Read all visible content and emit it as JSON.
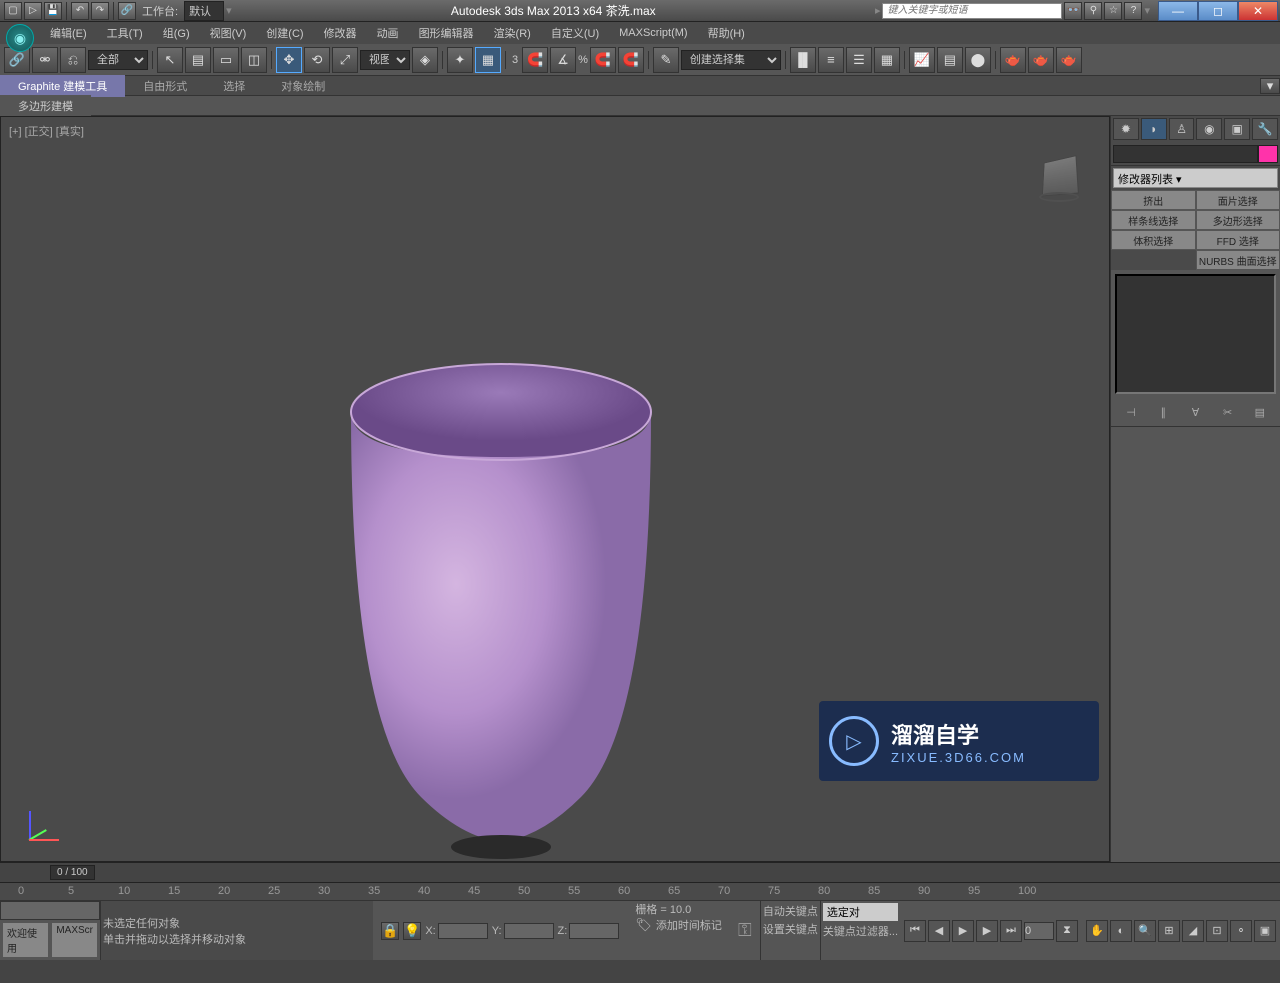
{
  "titlebar": {
    "app_title": "Autodesk 3ds Max  2013 x64     茶洗.max",
    "workspace_label": "工作台:",
    "workspace_value": "默认",
    "search_placeholder": "键入关键字或短语"
  },
  "menus": {
    "edit": "编辑(E)",
    "tools": "工具(T)",
    "group": "组(G)",
    "views": "视图(V)",
    "create": "创建(C)",
    "modifiers": "修改器",
    "animation": "动画",
    "graph": "图形编辑器",
    "rendering": "渲染(R)",
    "customize": "自定义(U)",
    "maxscript": "MAXScript(M)",
    "help": "帮助(H)"
  },
  "toolbar": {
    "filter_all": "全部",
    "view_label": "视图",
    "selset_label": "创建选择集"
  },
  "ribbon": {
    "graphite": "Graphite 建模工具",
    "freeform": "自由形式",
    "selection": "选择",
    "objectpaint": "对象绘制",
    "poly": "多边形建模"
  },
  "viewport": {
    "label": "[+] [正交] [真实]"
  },
  "cmdpanel": {
    "modifier_list": "修改器列表",
    "btn_extrude": "挤出",
    "btn_facesel": "面片选择",
    "btn_splinesel": "样条线选择",
    "btn_polysel": "多边形选择",
    "btn_volsel": "体积选择",
    "btn_ffdsel": "FFD 选择",
    "btn_nurbs": "NURBS 曲面选择"
  },
  "timeline": {
    "frame": "0 / 100",
    "marks": [
      "0",
      "5",
      "10",
      "15",
      "20",
      "25",
      "30",
      "35",
      "40",
      "45",
      "50",
      "55",
      "60",
      "65",
      "70",
      "75",
      "80",
      "85",
      "90",
      "95",
      "100"
    ]
  },
  "statusbar": {
    "welcome": "欢迎使用",
    "maxscr": "MAXScr",
    "prompt1": "未选定任何对象",
    "prompt2": "单击并拖动以选择并移动对象",
    "x": "X:",
    "y": "Y:",
    "z": "Z:",
    "grid": "栅格 = 10.0",
    "addtime": "添加时间标记",
    "autokey": "自动关键点",
    "setkey": "设置关键点",
    "selected": "选定对",
    "keyfilter": "关键点过滤器..."
  },
  "watermark": {
    "title": "溜溜自学",
    "sub": "ZIXUE.3D66.COM"
  }
}
